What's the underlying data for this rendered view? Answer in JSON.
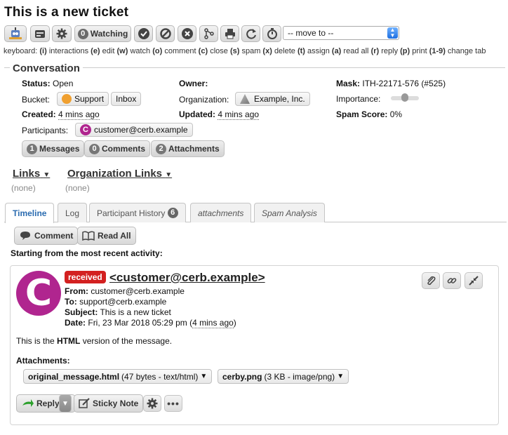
{
  "page": {
    "title": "This is a new ticket"
  },
  "toolbar": {
    "watching_count": "0",
    "watching_label": "Watching",
    "move_to_value": "-- move to --",
    "icons": [
      "bot-icon",
      "card-icon",
      "gear-icon",
      "watch-icon",
      "check-icon",
      "ban-icon",
      "close-icon",
      "split-icon",
      "print-icon",
      "refresh-icon",
      "timer-icon"
    ]
  },
  "keyboard_hint": {
    "prefix": "keyboard:",
    "items": [
      {
        "key": "(i)",
        "label": "interactions"
      },
      {
        "key": "(e)",
        "label": "edit"
      },
      {
        "key": "(w)",
        "label": "watch"
      },
      {
        "key": "(o)",
        "label": "comment"
      },
      {
        "key": "(c)",
        "label": "close"
      },
      {
        "key": "(s)",
        "label": "spam"
      },
      {
        "key": "(x)",
        "label": "delete"
      },
      {
        "key": "(t)",
        "label": "assign"
      },
      {
        "key": "(a)",
        "label": "read all"
      },
      {
        "key": "(r)",
        "label": "reply"
      },
      {
        "key": "(p)",
        "label": "print"
      },
      {
        "key": "(1-9)",
        "label": "change tab"
      }
    ]
  },
  "conversation": {
    "legend": "Conversation",
    "status_label": "Status:",
    "status_value": "Open",
    "owner_label": "Owner:",
    "mask_label": "Mask:",
    "mask_value": "ITH-22171-576 (#525)",
    "bucket_label": "Bucket:",
    "bucket_value": "Support",
    "inbox_value": "Inbox",
    "organization_label": "Organization:",
    "organization_value": "Example, Inc.",
    "importance_label": "Importance:",
    "importance_level": 0.5,
    "created_label": "Created:",
    "created_value": "4 mins ago",
    "updated_label": "Updated:",
    "updated_value": "4 mins ago",
    "spam_label": "Spam Score:",
    "spam_value": "0%",
    "participants_label": "Participants:",
    "participant": "customer@cerb.example",
    "participant_initial": "C",
    "counts": [
      {
        "count": "1",
        "label": "Messages"
      },
      {
        "count": "0",
        "label": "Comments"
      },
      {
        "count": "2",
        "label": "Attachments"
      }
    ]
  },
  "links": {
    "links_label": "Links",
    "links_value": "(none)",
    "org_links_label": "Organization Links",
    "org_links_value": "(none)"
  },
  "tabs": [
    {
      "label": "Timeline"
    },
    {
      "label": "Log"
    },
    {
      "label": "Participant History",
      "count": "6"
    },
    {
      "label": "attachments"
    },
    {
      "label": "Spam Analysis"
    }
  ],
  "actions": {
    "comment_label": "Comment",
    "read_all_label": "Read All"
  },
  "activity_heading": "Starting from the most recent activity:",
  "message": {
    "avatar_initial": "C",
    "badge": "received",
    "sender": "<customer@cerb.example>",
    "from_label": "From:",
    "from_value": "customer@cerb.example",
    "to_label": "To:",
    "to_value": "support@cerb.example",
    "subject_label": "Subject:",
    "subject_value": "This is a new ticket",
    "date_label": "Date:",
    "date_value": "Fri, 23 Mar 2018 05:29 pm (",
    "date_rel": "4 mins ago",
    "date_close": ")",
    "body_prefix": "This is the ",
    "body_bold": "HTML",
    "body_suffix": " version of the message.",
    "attachments_label": "Attachments:",
    "attachments": [
      {
        "name": "original_message.html",
        "meta": "(47 bytes - text/html)"
      },
      {
        "name": "cerby.png",
        "meta": "(3 KB - image/png)"
      }
    ],
    "reply_label": "Reply",
    "sticky_label": "Sticky Note"
  }
}
